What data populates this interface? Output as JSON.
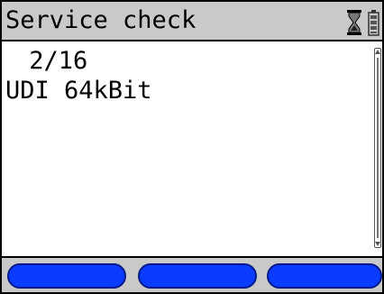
{
  "header": {
    "title": "Service check",
    "icons": [
      "hourglass-icon",
      "battery-icon"
    ]
  },
  "content": {
    "lines": [
      " 2/16",
      "UDI 64kBit"
    ]
  },
  "softkeys": [
    {
      "label": ""
    },
    {
      "label": ""
    },
    {
      "label": ""
    }
  ],
  "colors": {
    "title_bar": "#c9c9c9",
    "content_bg": "#ffffff",
    "softkey": "#0a3cff",
    "frame": "#000000"
  }
}
